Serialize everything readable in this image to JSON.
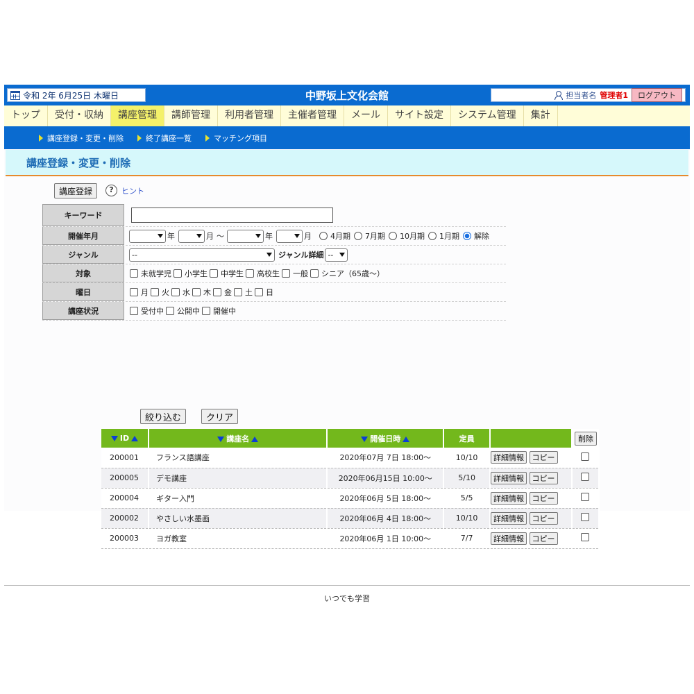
{
  "header": {
    "date": "令和 2年 6月25日 木曜日",
    "site_title": "中野坂上文化会館",
    "staff_label": "担当者名",
    "staff_name": "管理者1",
    "logout_label": "ログアウト"
  },
  "nav": {
    "items": [
      {
        "label": "トップ"
      },
      {
        "label": "受付・収納"
      },
      {
        "label": "講座管理",
        "active": true
      },
      {
        "label": "講師管理"
      },
      {
        "label": "利用者管理"
      },
      {
        "label": "主催者管理"
      },
      {
        "label": "メール"
      },
      {
        "label": "サイト設定"
      },
      {
        "label": "システム管理"
      },
      {
        "label": "集計"
      }
    ]
  },
  "subnav": {
    "items": [
      {
        "label": "講座登録・変更・削除"
      },
      {
        "label": "終了講座一覧"
      },
      {
        "label": "マッチング項目"
      }
    ]
  },
  "page": {
    "heading": "講座登録・変更・削除",
    "register_button": "講座登録",
    "hint_label": "ヒント"
  },
  "form": {
    "keyword_label": "キーワード",
    "keyword_value": "",
    "period_label": "開催年月",
    "year_unit": "年",
    "month_unit": "月",
    "range_sep": "～",
    "quarters": [
      {
        "label": "4月期",
        "checked": false
      },
      {
        "label": "7月期",
        "checked": false
      },
      {
        "label": "10月期",
        "checked": false
      },
      {
        "label": "1月期",
        "checked": false
      },
      {
        "label": "解除",
        "checked": true
      }
    ],
    "genre_label": "ジャンル",
    "genre_value": "--",
    "genre_detail_label": "ジャンル詳細",
    "genre_detail_value": "--",
    "target_label": "対象",
    "targets": [
      "未就学児",
      "小学生",
      "中学生",
      "高校生",
      "一般",
      "シニア（65歳～）"
    ],
    "weekday_label": "曜日",
    "weekdays": [
      "月",
      "火",
      "水",
      "木",
      "金",
      "土",
      "日"
    ],
    "status_label": "講座状況",
    "statuses": [
      "受付中",
      "公開中",
      "開催中"
    ],
    "filter_button": "絞り込む",
    "clear_button": "クリア"
  },
  "table": {
    "headers": {
      "id": "ID",
      "name": "講座名",
      "date": "開催日時",
      "capacity": "定員",
      "delete": "削除"
    },
    "detail_button": "詳細情報",
    "copy_button": "コピー",
    "rows": [
      {
        "id": "200001",
        "name": "フランス語講座",
        "date": "2020年07月 7日 18:00～",
        "capacity": "10/10"
      },
      {
        "id": "200005",
        "name": "デモ講座",
        "date": "2020年06月15日 10:00～",
        "capacity": "5/10"
      },
      {
        "id": "200004",
        "name": "ギター入門",
        "date": "2020年06月 5日 18:00～",
        "capacity": "5/5"
      },
      {
        "id": "200002",
        "name": "やさしい水墨画",
        "date": "2020年06月 4日 18:00～",
        "capacity": "10/10"
      },
      {
        "id": "200003",
        "name": "ヨガ教室",
        "date": "2020年06月 1日 10:00～",
        "capacity": "7/7"
      }
    ]
  },
  "footer": {
    "text": "いつでも学習"
  },
  "colors": {
    "header_blue": "#0a6bd0",
    "nav_bg": "#fffdd8",
    "nav_active": "#f4f16a",
    "heading_bg": "#d6f8fb",
    "heading_border": "#e68a2e",
    "table_header": "#73b81c",
    "staff_name": "#e00000",
    "logout_bg": "#f7b8c3"
  }
}
